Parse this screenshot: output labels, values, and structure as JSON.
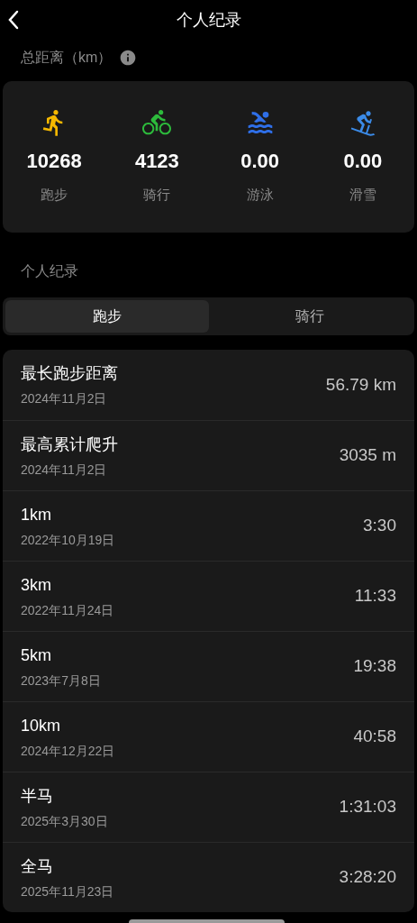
{
  "header": {
    "title": "个人纪录"
  },
  "totals": {
    "label": "总距离（km）",
    "items": [
      {
        "kind": "run",
        "color": "#f5b800",
        "value": "10268",
        "label": "跑步"
      },
      {
        "kind": "bike",
        "color": "#2dbb3c",
        "value": "4123",
        "label": "骑行"
      },
      {
        "kind": "swim",
        "color": "#2f6fe8",
        "value": "0.00",
        "label": "游泳"
      },
      {
        "kind": "ski",
        "color": "#3b8be8",
        "value": "0.00",
        "label": "滑雪"
      }
    ]
  },
  "records": {
    "label": "个人纪录",
    "tabs": [
      {
        "label": "跑步",
        "selected": true
      },
      {
        "label": "骑行",
        "selected": false
      }
    ],
    "rows": [
      {
        "name": "最长跑步距离",
        "date": "2024年11月2日",
        "value": "56.79 km"
      },
      {
        "name": "最高累计爬升",
        "date": "2024年11月2日",
        "value": "3035 m"
      },
      {
        "name": "1km",
        "date": "2022年10月19日",
        "value": "3:30"
      },
      {
        "name": "3km",
        "date": "2022年11月24日",
        "value": "11:33"
      },
      {
        "name": "5km",
        "date": "2023年7月8日",
        "value": "19:38"
      },
      {
        "name": "10km",
        "date": "2024年12月22日",
        "value": "40:58"
      },
      {
        "name": "半马",
        "date": "2025年3月30日",
        "value": "1:31:03"
      },
      {
        "name": "全马",
        "date": "2025年11月23日",
        "value": "3:28:20"
      }
    ]
  }
}
